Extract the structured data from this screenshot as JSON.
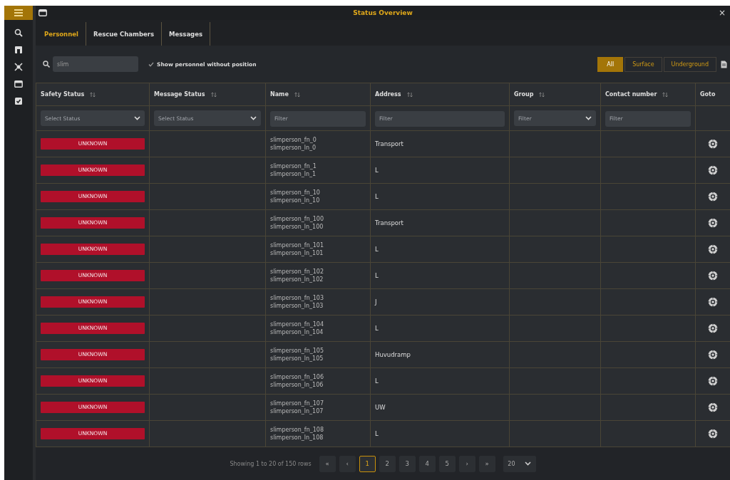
{
  "window": {
    "title": "Status Overview",
    "close": "×"
  },
  "tabs": [
    {
      "label": "Personnel",
      "selected": true
    },
    {
      "label": "Rescue Chambers",
      "selected": false
    },
    {
      "label": "Messages",
      "selected": false
    }
  ],
  "search": {
    "value": "slim"
  },
  "show_without_position": {
    "label": "Show personnel without position",
    "checked": true
  },
  "location_filter": [
    {
      "label": "All",
      "selected": true
    },
    {
      "label": "Surface",
      "selected": false
    },
    {
      "label": "Underground",
      "selected": false
    }
  ],
  "table": {
    "columns": [
      {
        "label": "Safety Status",
        "sortable": true,
        "filter": {
          "kind": "select",
          "placeholder": "Select Status"
        }
      },
      {
        "label": "Message Status",
        "sortable": true,
        "filter": {
          "kind": "select",
          "placeholder": "Select Status"
        }
      },
      {
        "label": "Name",
        "sortable": true,
        "filter": {
          "kind": "text",
          "placeholder": "Filter"
        }
      },
      {
        "label": "Address",
        "sortable": true,
        "filter": {
          "kind": "text",
          "placeholder": "Filter"
        }
      },
      {
        "label": "Group",
        "sortable": true,
        "filter": {
          "kind": "select",
          "placeholder": "Filter"
        }
      },
      {
        "label": "Contact number",
        "sortable": true,
        "filter": {
          "kind": "text",
          "placeholder": "Filter"
        }
      },
      {
        "label": "Goto",
        "sortable": false
      }
    ],
    "rows": [
      {
        "safety_status": "UNKNOWN",
        "first_name": "slimperson_fn_0",
        "last_name": "slimperson_ln_0",
        "address": "Transport"
      },
      {
        "safety_status": "UNKNOWN",
        "first_name": "slimperson_fn_1",
        "last_name": "slimperson_ln_1",
        "address": "L"
      },
      {
        "safety_status": "UNKNOWN",
        "first_name": "slimperson_fn_10",
        "last_name": "slimperson_ln_10",
        "address": "L"
      },
      {
        "safety_status": "UNKNOWN",
        "first_name": "slimperson_fn_100",
        "last_name": "slimperson_ln_100",
        "address": "Transport"
      },
      {
        "safety_status": "UNKNOWN",
        "first_name": "slimperson_fn_101",
        "last_name": "slimperson_ln_101",
        "address": "L"
      },
      {
        "safety_status": "UNKNOWN",
        "first_name": "slimperson_fn_102",
        "last_name": "slimperson_ln_102",
        "address": "L"
      },
      {
        "safety_status": "UNKNOWN",
        "first_name": "slimperson_fn_103",
        "last_name": "slimperson_ln_103",
        "address": "J"
      },
      {
        "safety_status": "UNKNOWN",
        "first_name": "slimperson_fn_104",
        "last_name": "slimperson_ln_104",
        "address": "L"
      },
      {
        "safety_status": "UNKNOWN",
        "first_name": "slimperson_fn_105",
        "last_name": "slimperson_ln_105",
        "address": "Huvudramp"
      },
      {
        "safety_status": "UNKNOWN",
        "first_name": "slimperson_fn_106",
        "last_name": "slimperson_ln_106",
        "address": "L"
      },
      {
        "safety_status": "UNKNOWN",
        "first_name": "slimperson_fn_107",
        "last_name": "slimperson_ln_107",
        "address": "UW"
      },
      {
        "safety_status": "UNKNOWN",
        "first_name": "slimperson_fn_108",
        "last_name": "slimperson_ln_108",
        "address": "L"
      }
    ]
  },
  "pagination": {
    "summary": "Showing 1 to 20 of 150 rows",
    "first": "«",
    "prev": "‹",
    "pages": [
      {
        "label": "1",
        "selected": true
      },
      {
        "label": "2",
        "selected": false
      },
      {
        "label": "3",
        "selected": false
      },
      {
        "label": "4",
        "selected": false
      },
      {
        "label": "5",
        "selected": false
      }
    ],
    "next": "›",
    "last": "»",
    "page_size": "20"
  }
}
